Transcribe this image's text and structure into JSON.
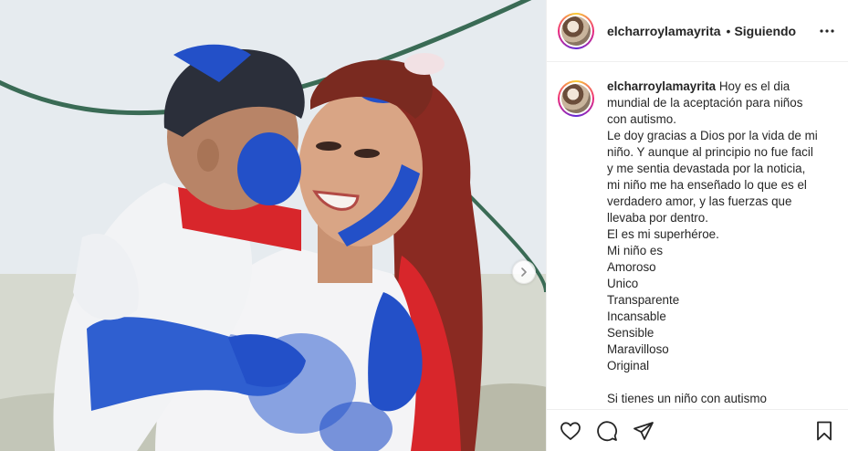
{
  "post": {
    "username": "elcharroylamayrita",
    "separator": "•",
    "follow_status": "Siguiendo"
  },
  "caption": {
    "username": "elcharroylamayrita",
    "first_line": "Hoy es el dia",
    "lines": [
      "mundial de la aceptación para niños",
      "con autismo.",
      "Le doy gracias a Dios por la vida de mi",
      "niño. Y aunque al principio no fue facil",
      "y me sentia devastada por la noticia,",
      "mi niño me ha enseñado lo que es el",
      "verdadero amor, y las fuerzas que",
      "llevaba por dentro.",
      "El es mi superhéroe.",
      "Mi niño es",
      "Amoroso",
      "Unico",
      "Transparente",
      "Incansable",
      "Sensible",
      "Maravilloso",
      "Original",
      "",
      "Si tienes un niño con autismo"
    ]
  },
  "icons": {
    "more": "more-options-icon",
    "next": "chevron-right-icon",
    "like": "heart-icon",
    "comment": "comment-icon",
    "share": "paper-plane-icon",
    "save": "bookmark-icon"
  },
  "colors": {
    "text": "#262626",
    "divider": "#efefef",
    "paint_blue": "#2350c8",
    "scarf_red": "#d8262b"
  }
}
